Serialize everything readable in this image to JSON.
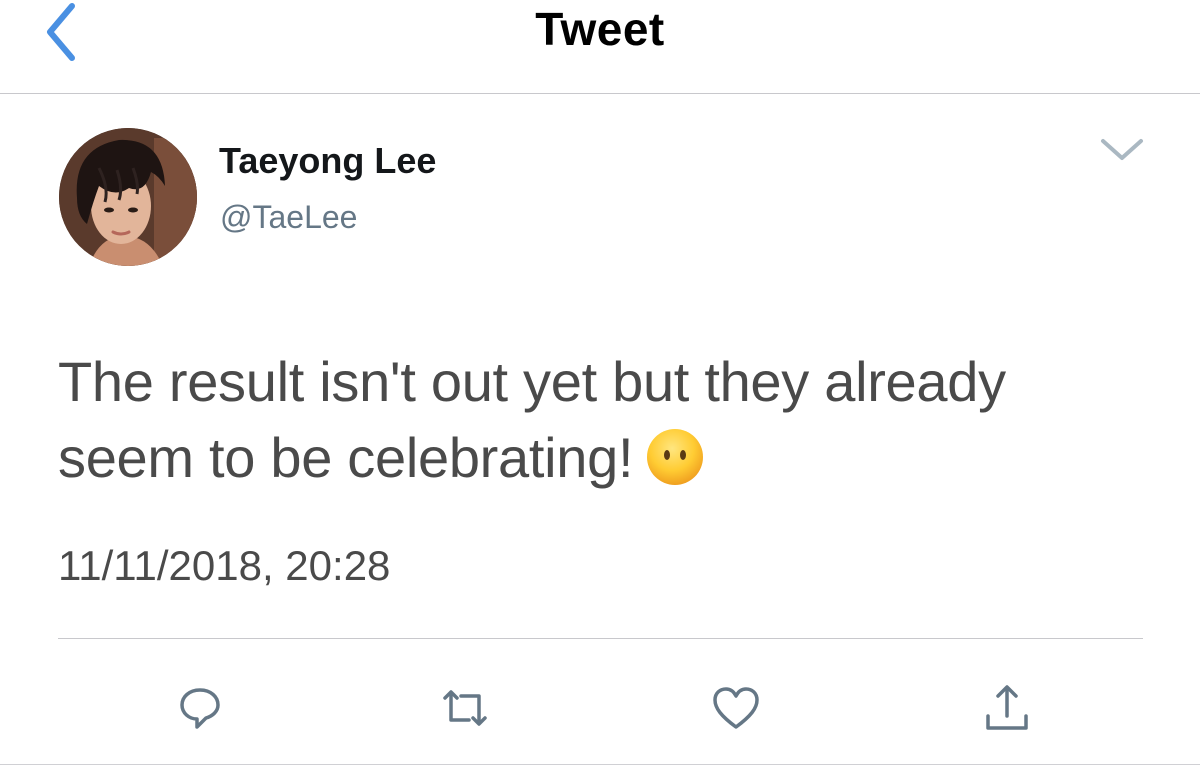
{
  "nav": {
    "title": "Tweet",
    "back_icon": "chevron-left-icon",
    "accent_color": "#4a90e2"
  },
  "tweet": {
    "author": {
      "display_name": "Taeyong Lee",
      "handle": "@TaeLee"
    },
    "text_line_1": "The result isn't out yet but they already",
    "text_line_2": "seem to be celebrating!",
    "emoji": "face-without-mouth-emoji",
    "timestamp": "11/11/2018, 20:28",
    "more_icon": "chevron-down-icon"
  },
  "actions": [
    {
      "name": "reply",
      "icon": "comment-bubble-icon"
    },
    {
      "name": "retweet",
      "icon": "retweet-icon"
    },
    {
      "name": "like",
      "icon": "heart-icon"
    },
    {
      "name": "share",
      "icon": "share-icon"
    }
  ],
  "colors": {
    "text_primary": "#14171a",
    "text_body": "#4a4a4a",
    "text_secondary": "#657786",
    "icon_gray": "#657786",
    "divider": "#c8c8cc"
  }
}
